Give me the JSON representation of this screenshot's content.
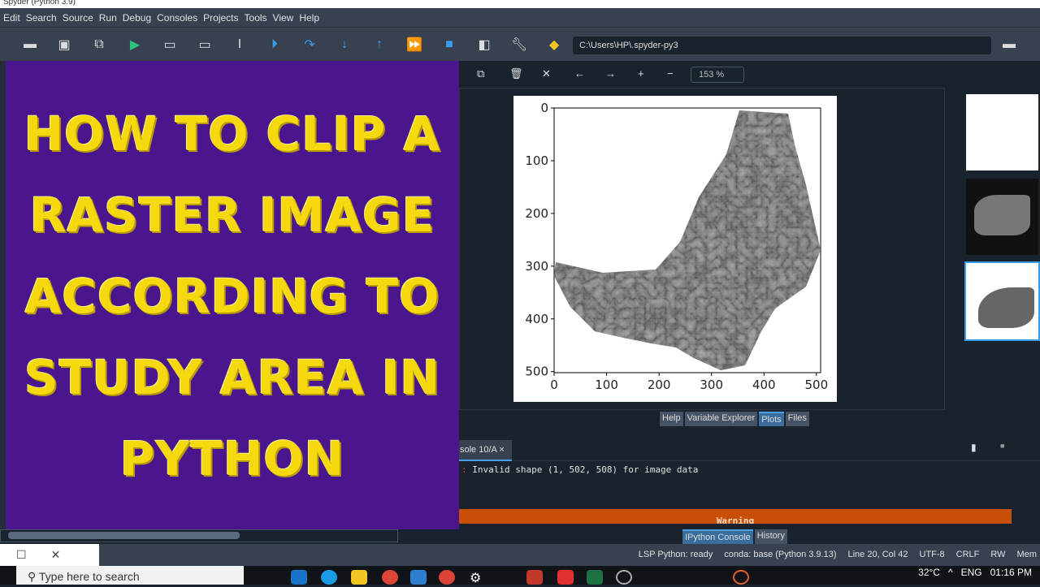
{
  "window": {
    "title": "Spyder (Python 3.9)"
  },
  "menu": [
    "Edit",
    "Search",
    "Source",
    "Run",
    "Debug",
    "Consoles",
    "Projects",
    "Tools",
    "View",
    "Help"
  ],
  "toolbar": {
    "path": "C:\\Users\\HP\\.spyder-py3"
  },
  "overlay": {
    "lines": [
      "HOW TO CLIP A",
      "RASTER IMAGE",
      "ACCORDING TO",
      "STUDY AREA IN",
      "PYTHON"
    ]
  },
  "plots": {
    "zoom": "153 %",
    "xticks": [
      "0",
      "100",
      "200",
      "300",
      "400",
      "500"
    ],
    "yticks": [
      "0",
      "100",
      "200",
      "300",
      "400",
      "500"
    ]
  },
  "pane_tabs": [
    "Help",
    "Variable Explorer",
    "Plots",
    "Files"
  ],
  "console": {
    "tab": "sole 10/A",
    "close": "×",
    "message": "Invalid shape (1, 502, 508) for image data",
    "warning": "Warning"
  },
  "console_tabs": [
    "IPython Console",
    "History"
  ],
  "status": [
    "LSP Python: ready",
    "conda: base (Python 3.9.13)",
    "Line 20, Col 42",
    "UTF-8",
    "CRLF",
    "RW",
    "Mem"
  ],
  "taskbar": {
    "search": "Type here to search",
    "weather": "32°C",
    "lang": "ENG",
    "time": "01:16 PM"
  },
  "colors": {
    "overlay_bg": "#4a168e",
    "headline": "#f6d80f",
    "warning": "#c84f05"
  }
}
